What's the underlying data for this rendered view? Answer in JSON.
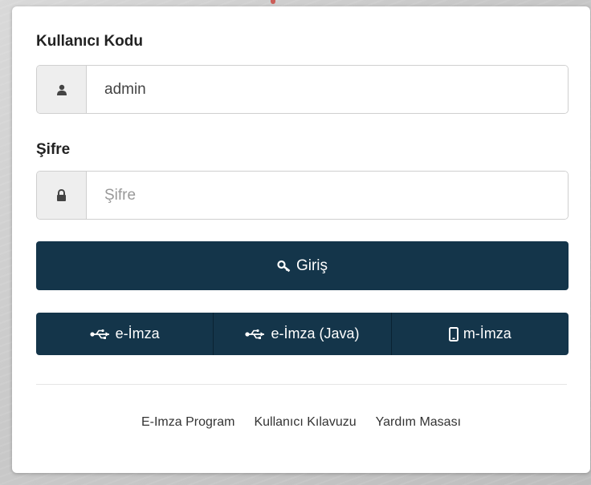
{
  "login": {
    "username_label": "Kullanıcı Kodu",
    "username_value": "admin",
    "password_label": "Şifre",
    "password_placeholder": "Şifre",
    "login_button": "Giriş"
  },
  "signature_buttons": [
    {
      "label": "e-İmza",
      "icon": "usb-icon"
    },
    {
      "label": "e-İmza (Java)",
      "icon": "usb-icon"
    },
    {
      "label": "m-İmza",
      "icon": "mobile-phone-icon"
    }
  ],
  "footer_links": [
    {
      "label": "E-Imza Program"
    },
    {
      "label": "Kullanıcı Kılavuzu"
    },
    {
      "label": "Yardım Masası"
    }
  ],
  "colors": {
    "button_bg": "#14354a",
    "page_bg": "#cccccc",
    "card_bg": "#ffffff"
  }
}
